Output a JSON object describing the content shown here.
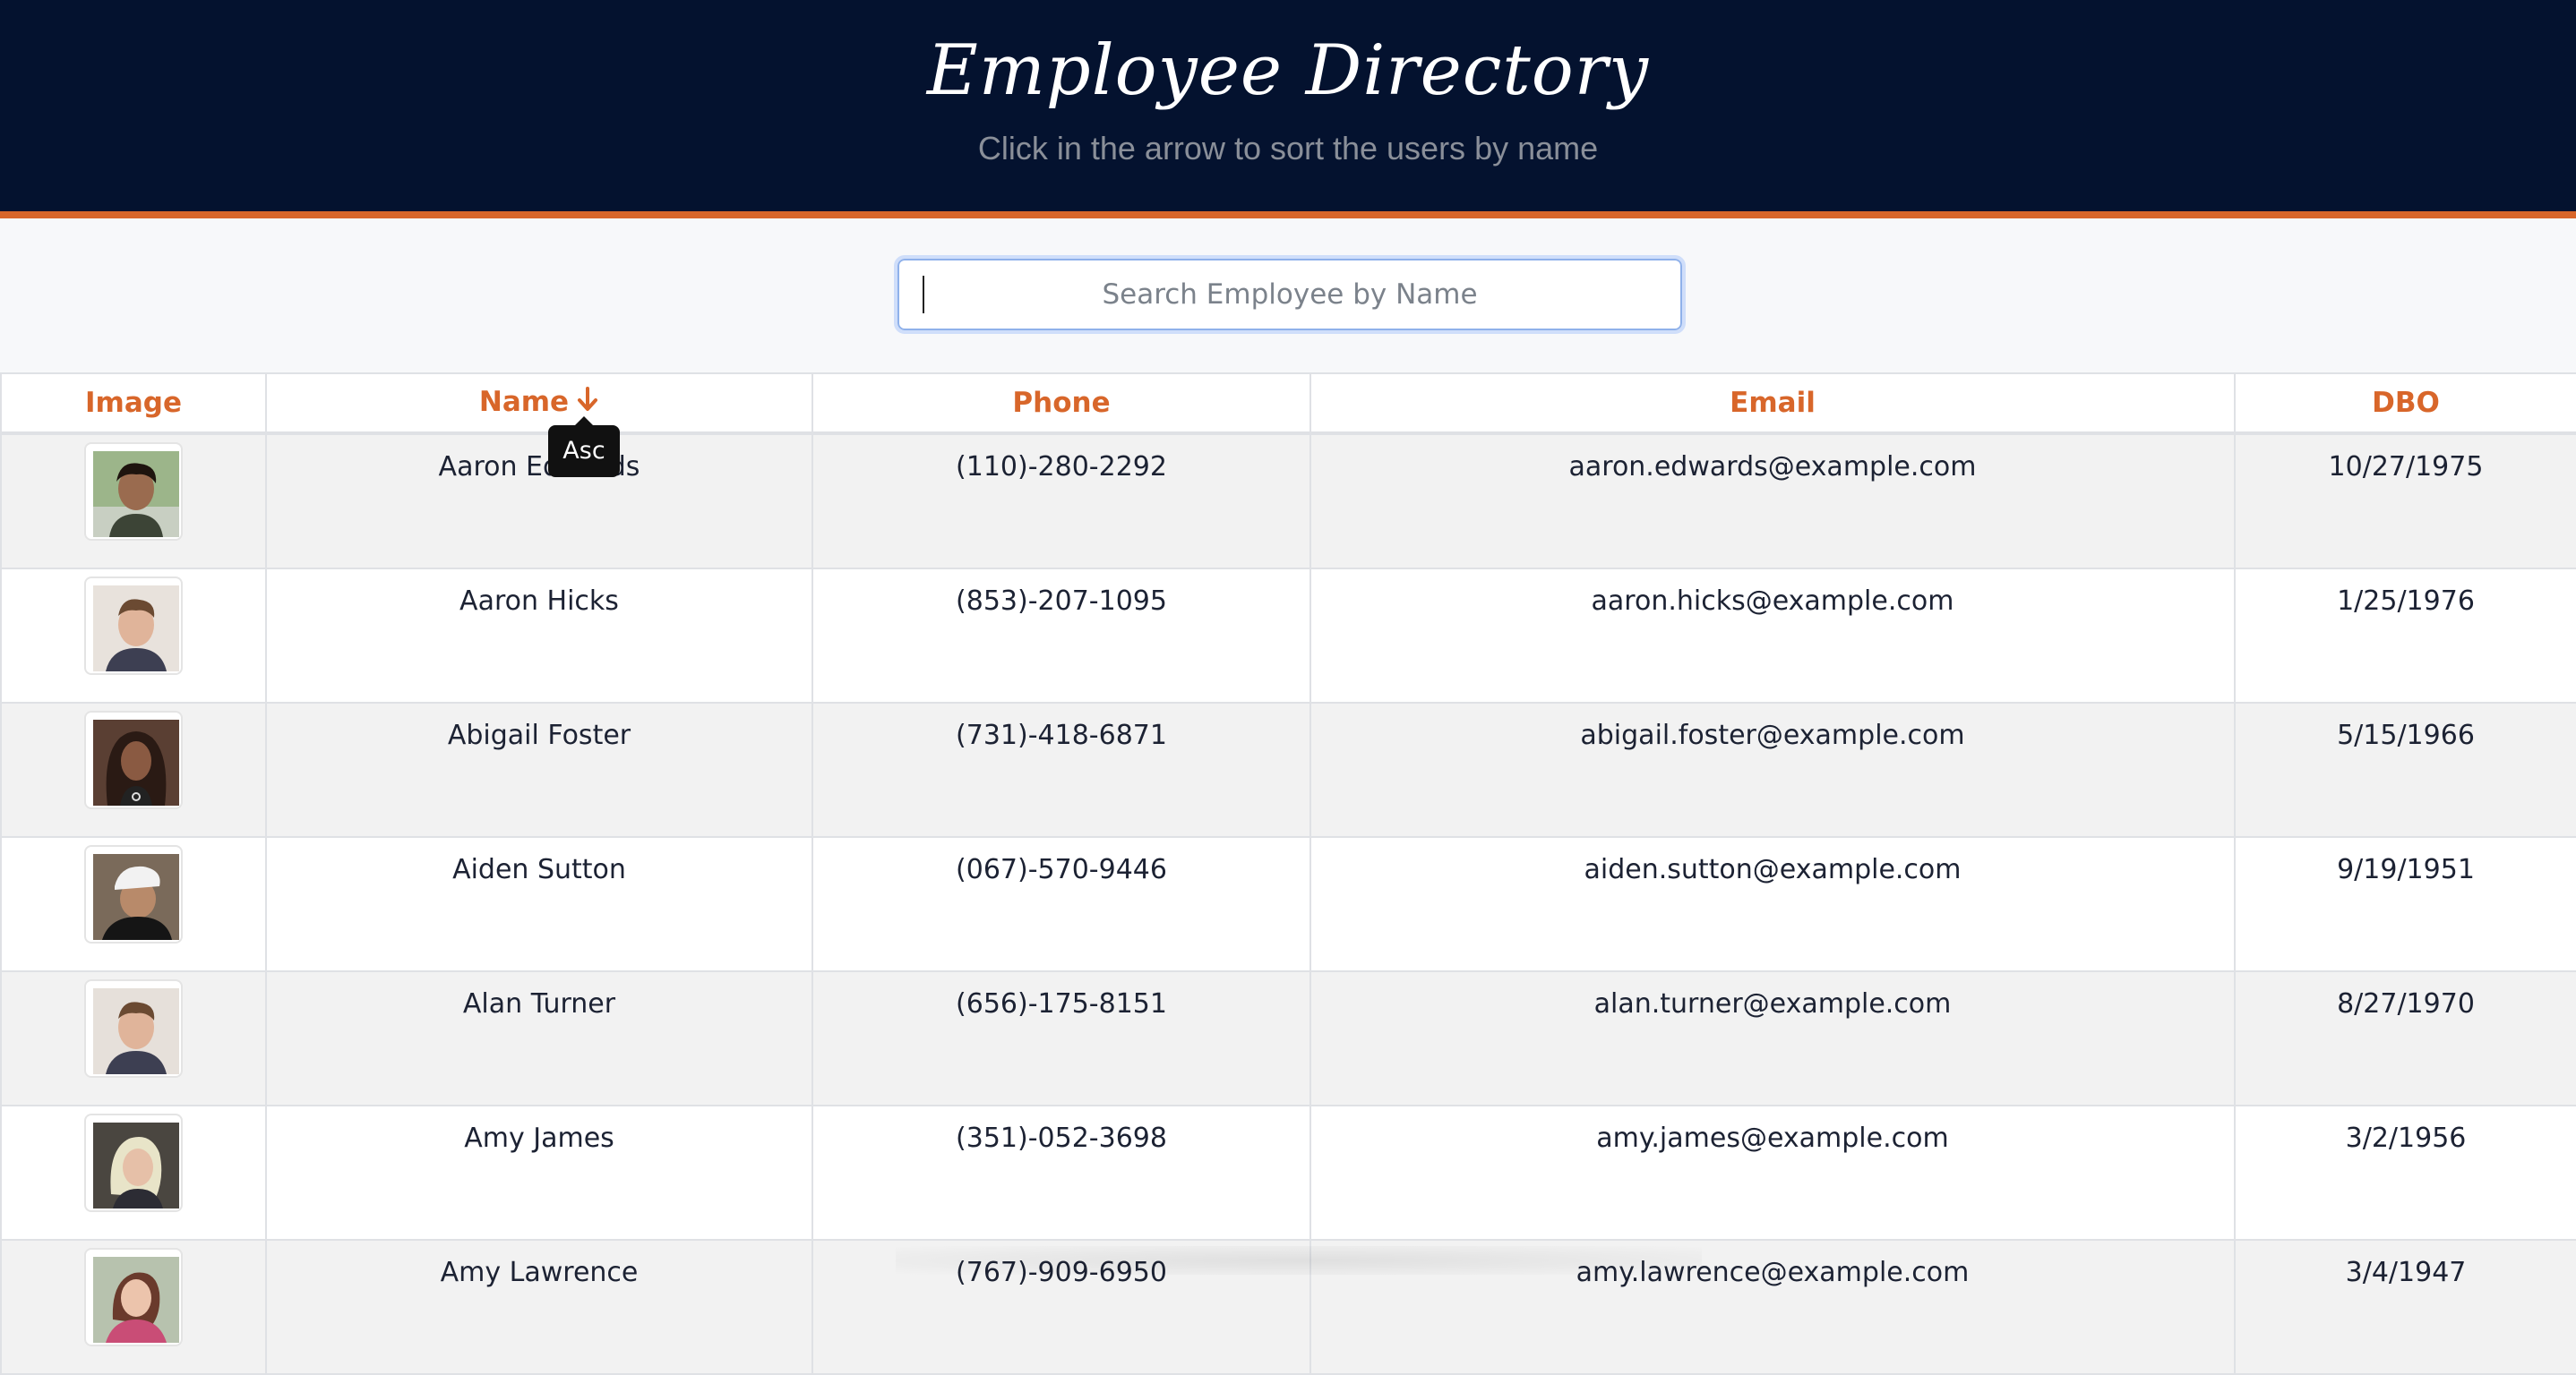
{
  "header": {
    "title": "Employee Directory",
    "subtitle": "Click in the arrow to sort the users by name"
  },
  "search": {
    "placeholder": "Search Employee by Name",
    "value": ""
  },
  "table": {
    "columns": [
      "Image",
      "Name",
      "Phone",
      "Email",
      "DBO"
    ],
    "sort": {
      "column": "Name",
      "direction_tooltip": "Asc",
      "icon": "arrow-down-icon"
    },
    "rows": [
      {
        "name": "Aaron Edwards",
        "phone": "(110)-280-2292",
        "email": "aaron.edwards@example.com",
        "dob": "10/27/1975"
      },
      {
        "name": "Aaron Hicks",
        "phone": "(853)-207-1095",
        "email": "aaron.hicks@example.com",
        "dob": "1/25/1976"
      },
      {
        "name": "Abigail Foster",
        "phone": "(731)-418-6871",
        "email": "abigail.foster@example.com",
        "dob": "5/15/1966"
      },
      {
        "name": "Aiden Sutton",
        "phone": "(067)-570-9446",
        "email": "aiden.sutton@example.com",
        "dob": "9/19/1951"
      },
      {
        "name": "Alan Turner",
        "phone": "(656)-175-8151",
        "email": "alan.turner@example.com",
        "dob": "8/27/1970"
      },
      {
        "name": "Amy James",
        "phone": "(351)-052-3698",
        "email": "amy.james@example.com",
        "dob": "3/2/1956"
      },
      {
        "name": "Amy Lawrence",
        "phone": "(767)-909-6950",
        "email": "amy.lawrence@example.com",
        "dob": "3/4/1947"
      }
    ]
  },
  "colors": {
    "header_bg": "#04122f",
    "accent": "#d8662a",
    "row_stripe": "#f2f2f2"
  }
}
